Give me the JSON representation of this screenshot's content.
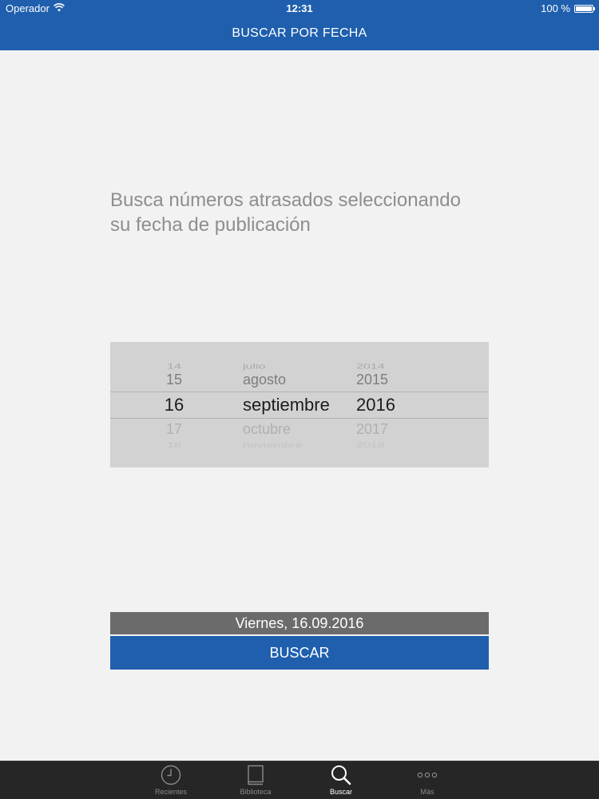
{
  "status_bar": {
    "carrier": "Operador",
    "time": "12:31",
    "battery": "100 %"
  },
  "nav": {
    "title": "BUSCAR POR FECHA"
  },
  "prompt": {
    "line1": "Busca números atrasados seleccionando",
    "line2": "su fecha de publicación"
  },
  "picker": {
    "rows": [
      {
        "day": "14",
        "month": "julio",
        "year": "2014"
      },
      {
        "day": "15",
        "month": "agosto",
        "year": "2015"
      },
      {
        "day": "16",
        "month": "septiembre",
        "year": "2016"
      },
      {
        "day": "17",
        "month": "octubre",
        "year": "2017"
      },
      {
        "day": "18",
        "month": "noviembre",
        "year": "2018"
      }
    ],
    "selected_index": 2
  },
  "selected_date_label": "Viernes, 16.09.2016",
  "search_button_label": "BUSCAR",
  "tabs": [
    {
      "label": "Recientes",
      "icon": "clock-icon",
      "active": false
    },
    {
      "label": "Biblioteca",
      "icon": "book-icon",
      "active": false
    },
    {
      "label": "Buscar",
      "icon": "search-icon",
      "active": true
    },
    {
      "label": "Más",
      "icon": "more-icon",
      "active": false
    }
  ],
  "colors": {
    "brand_blue": "#1f5fae",
    "date_bar": "#6b6b6b",
    "tab_bar": "#262626"
  }
}
